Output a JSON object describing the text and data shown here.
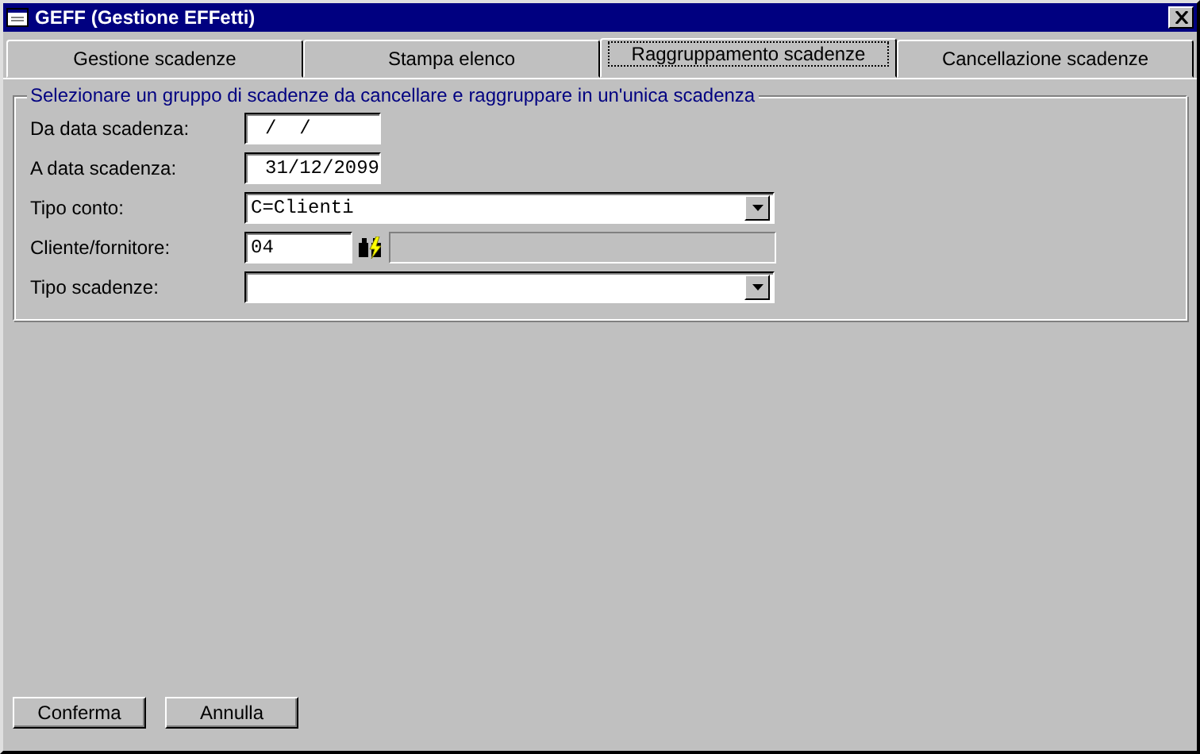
{
  "window": {
    "title": "GEFF (Gestione EFFetti)"
  },
  "tabs": [
    {
      "label": "Gestione scadenze",
      "selected": false
    },
    {
      "label": "Stampa elenco",
      "selected": false
    },
    {
      "label": "Raggruppamento scadenze",
      "selected": true
    },
    {
      "label": "Cancellazione scadenze",
      "selected": false
    }
  ],
  "group": {
    "title": "Selezionare un gruppo di scadenze da cancellare e raggruppare in un'unica scadenza"
  },
  "fields": [
    {
      "kind": "date",
      "label": "Da data scadenza:",
      "value": "/  /"
    },
    {
      "kind": "date",
      "label": "A data scadenza:",
      "value": "31/12/2099"
    },
    {
      "kind": "dropdown",
      "label": "Tipo conto:",
      "value": "C=Clienti"
    },
    {
      "kind": "lookup",
      "label": "Cliente/fornitore:",
      "value": "04"
    },
    {
      "kind": "dropdown",
      "label": "Tipo scadenze:"
    }
  ],
  "buttons": [
    "Conferma",
    "Annulla"
  ]
}
